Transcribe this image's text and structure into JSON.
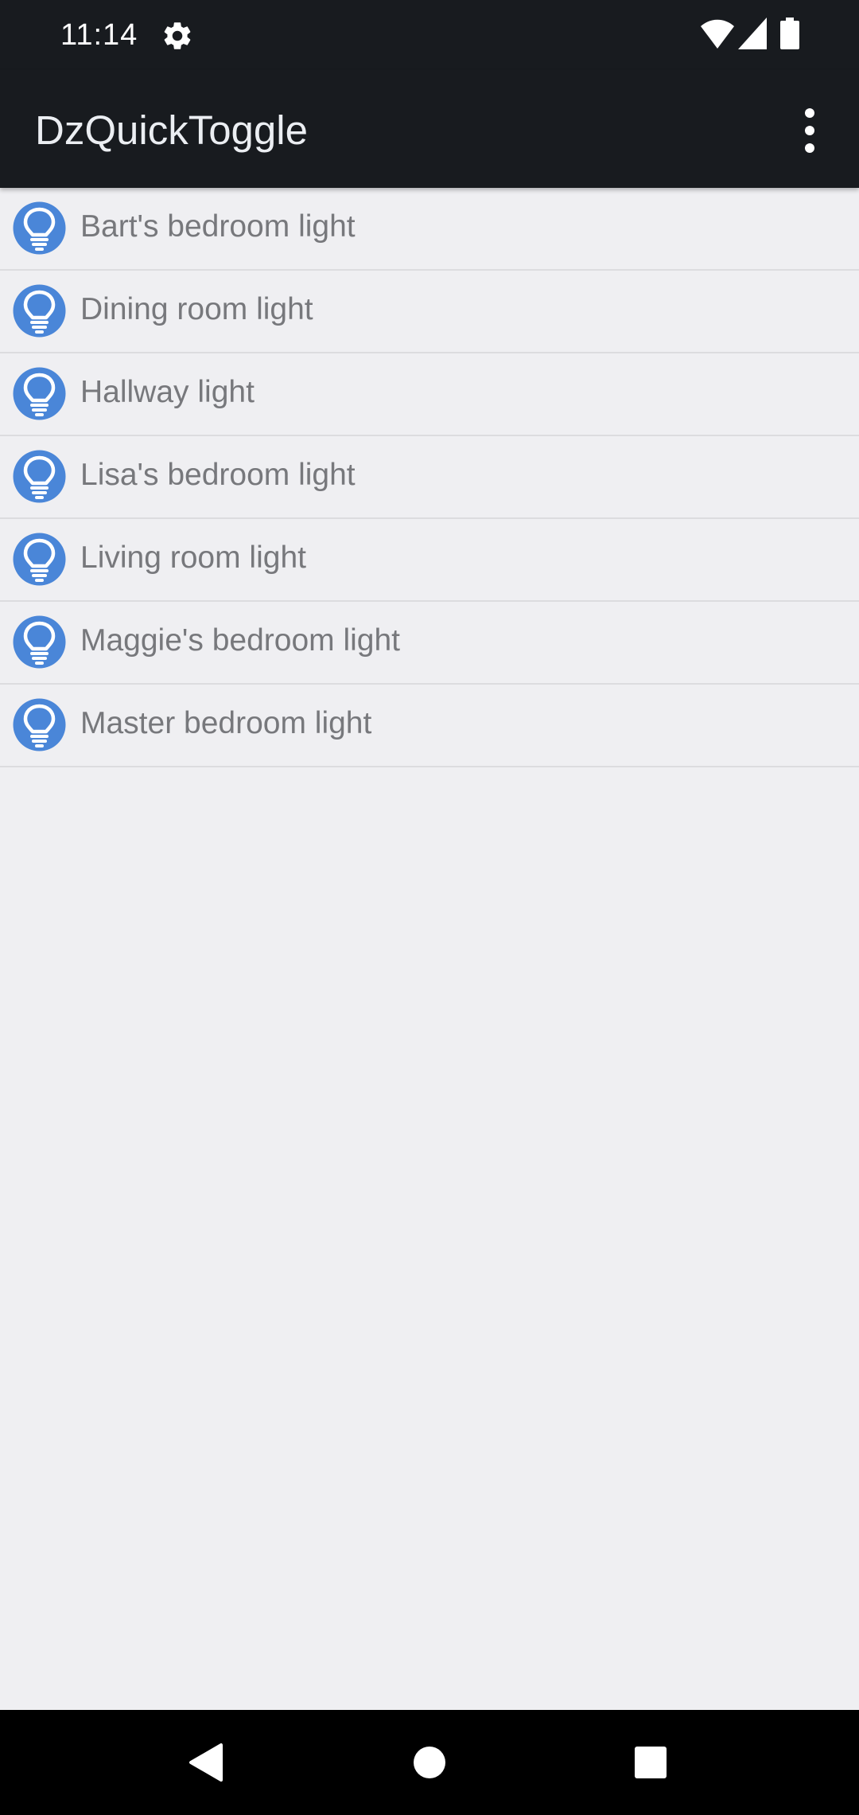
{
  "status_bar": {
    "time": "11:14",
    "icons": [
      "settings-icon",
      "wifi-icon",
      "cell-signal-icon",
      "battery-icon"
    ]
  },
  "app_bar": {
    "title": "DzQuickToggle",
    "overflow_icon": "more-vert-icon"
  },
  "colors": {
    "bar_background": "#181b1f",
    "list_background": "#efeff2",
    "icon_accent": "#4a86d8",
    "label_text": "#77787c"
  },
  "devices": [
    {
      "label": "Bart's bedroom light",
      "icon": "lightbulb-icon"
    },
    {
      "label": "Dining room light",
      "icon": "lightbulb-icon"
    },
    {
      "label": "Hallway light",
      "icon": "lightbulb-icon"
    },
    {
      "label": "Lisa's bedroom light",
      "icon": "lightbulb-icon"
    },
    {
      "label": "Living room light",
      "icon": "lightbulb-icon"
    },
    {
      "label": "Maggie's bedroom light",
      "icon": "lightbulb-icon"
    },
    {
      "label": "Master bedroom light",
      "icon": "lightbulb-icon"
    }
  ],
  "nav_bar": {
    "icons": [
      "back-icon",
      "home-icon",
      "recents-icon"
    ]
  }
}
